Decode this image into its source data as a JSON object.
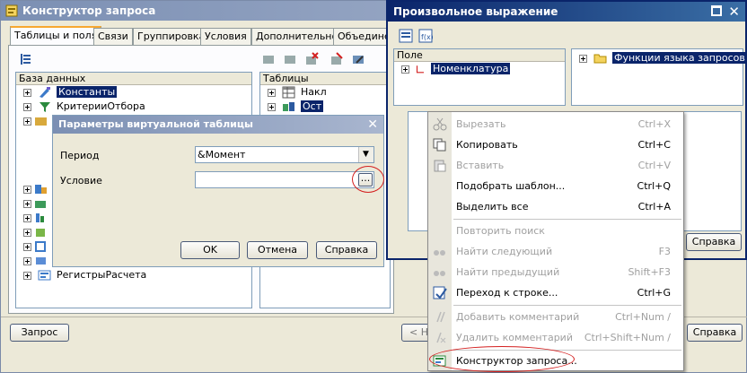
{
  "colors": {
    "accent": "#0a246a",
    "highlight_ellipse": "#d42020",
    "tab_accent": "#f7a830"
  },
  "main_window": {
    "title": "Конструктор запроса",
    "tabs": [
      {
        "label": "Таблицы и поля",
        "selected": true
      },
      {
        "label": "Связи",
        "selected": false
      },
      {
        "label": "Группировка",
        "selected": false
      },
      {
        "label": "Условия",
        "selected": false
      },
      {
        "label": "Дополнительно",
        "selected": false
      },
      {
        "label": "Объединен",
        "selected": false
      }
    ],
    "database_panel": {
      "header": "База данных",
      "items": [
        {
          "label": "Константы",
          "icon": "constants-icon",
          "selected": true
        },
        {
          "label": "КритерииОтбора",
          "icon": "filter-criteria-icon",
          "selected": false
        },
        {
          "label": "РегистрыРасчета",
          "icon": "calc-registers-icon",
          "selected": false
        }
      ]
    },
    "tables_panel": {
      "header": "Таблицы",
      "items": [
        {
          "label": "Накл",
          "icon": "table-icon",
          "selected": false
        },
        {
          "label": "Ост",
          "icon": "virtual-table-icon",
          "selected": true
        }
      ]
    },
    "query_button": "Запрос",
    "back_button_partial": "< Н"
  },
  "virtual_table_dialog": {
    "title": "Параметры виртуальной таблицы",
    "period_label": "Период",
    "period_value": "&Момент",
    "condition_label": "Условие",
    "condition_value": "",
    "ellipsis": "...",
    "ok": "OK",
    "cancel": "Отмена",
    "help": "Справка"
  },
  "expression_window": {
    "title": "Произвольное выражение",
    "fields_header": "Поле",
    "fields_items": [
      {
        "label": "Номенклатура",
        "selected": true
      }
    ],
    "functions_items": [
      {
        "label": "Функции языка запросов",
        "selected": true
      }
    ],
    "help": "Справка",
    "bottom_help": "Справка"
  },
  "context_menu": {
    "items": [
      {
        "label": "Вырезать",
        "shortcut": "Ctrl+X",
        "enabled": false,
        "icon": "cut-icon"
      },
      {
        "label": "Копировать",
        "shortcut": "Ctrl+C",
        "enabled": true,
        "icon": "copy-icon"
      },
      {
        "label": "Вставить",
        "shortcut": "Ctrl+V",
        "enabled": false,
        "icon": "paste-icon"
      },
      {
        "label": "Подобрать шаблон...",
        "shortcut": "Ctrl+Q",
        "enabled": true,
        "icon": ""
      },
      {
        "label": "Выделить все",
        "shortcut": "Ctrl+A",
        "enabled": true,
        "icon": ""
      },
      {
        "separator": true
      },
      {
        "label": "Повторить поиск",
        "shortcut": "",
        "enabled": false,
        "icon": ""
      },
      {
        "label": "Найти следующий",
        "shortcut": "F3",
        "enabled": false,
        "icon": "find-next-icon"
      },
      {
        "label": "Найти предыдущий",
        "shortcut": "Shift+F3",
        "enabled": false,
        "icon": "find-prev-icon"
      },
      {
        "label": "Переход к строке...",
        "shortcut": "Ctrl+G",
        "enabled": true,
        "icon": "goto-line-icon"
      },
      {
        "separator": true
      },
      {
        "label": "Добавить комментарий",
        "shortcut": "Ctrl+Num /",
        "enabled": false,
        "icon": "add-comment-icon"
      },
      {
        "label": "Удалить комментарий",
        "shortcut": "Ctrl+Shift+Num /",
        "enabled": false,
        "icon": "remove-comment-icon"
      },
      {
        "separator": true
      },
      {
        "label": "Конструктор запроса...",
        "shortcut": "",
        "enabled": true,
        "icon": "query-builder-icon"
      }
    ]
  }
}
